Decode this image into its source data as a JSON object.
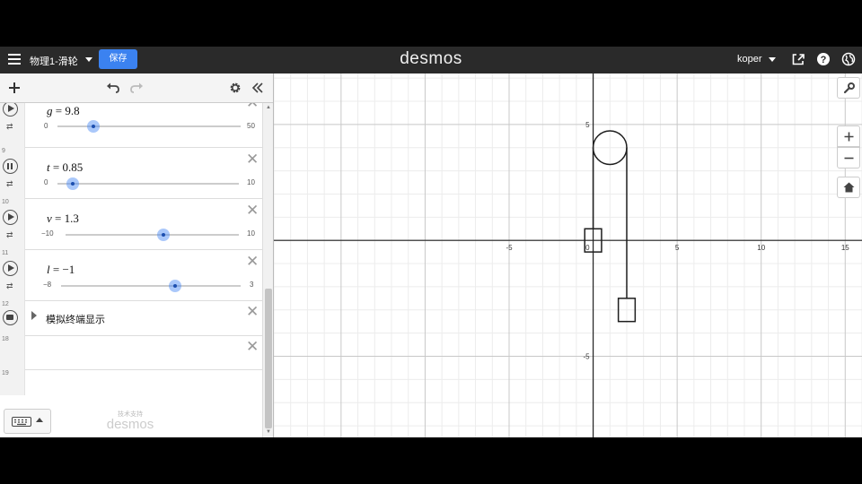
{
  "header": {
    "graph_title": "物理1-滑轮",
    "save_label": "保存",
    "logo": "desmos",
    "user_name": "koper"
  },
  "expressions": [
    {
      "row_number": "",
      "lhs": "g",
      "rhs": "9.8",
      "slider_min": "0",
      "slider_max": "50",
      "state": "play",
      "fraction": 0.196
    },
    {
      "row_number": "9",
      "lhs": "t",
      "rhs": "0.85",
      "slider_min": "0",
      "slider_max": "10",
      "state": "pause",
      "fraction": 0.085
    },
    {
      "row_number": "10",
      "lhs": "v",
      "rhs": "1.3",
      "slider_min": "−10",
      "slider_max": "10",
      "state": "play",
      "fraction": 0.565
    },
    {
      "row_number": "11",
      "lhs": "l",
      "rhs": "−1",
      "slider_min": "−8",
      "slider_max": "3",
      "state": "play",
      "fraction": 0.636
    }
  ],
  "folder": {
    "row_number": "12",
    "label": "模拟终端显示"
  },
  "empty_rows": [
    "18",
    "19"
  ],
  "footer": {
    "powered_by": "技术支持",
    "logo": "desmos"
  },
  "graph": {
    "x_range": [
      -19,
      16
    ],
    "y_range": [
      -8.5,
      7.2
    ],
    "x_ticks": [
      "-5",
      "5",
      "10",
      "15"
    ],
    "y_ticks": [
      "5",
      "-5"
    ],
    "origin_label": "0",
    "pulley": {
      "center": [
        1,
        4
      ],
      "radius": 1
    },
    "left_box": {
      "center": [
        0,
        0
      ],
      "size": 1
    },
    "right_box": {
      "center": [
        2,
        -3
      ],
      "size": 1
    }
  },
  "icons": [
    "menu-icon",
    "share-icon",
    "help-icon",
    "globe-icon",
    "add-icon",
    "undo-icon",
    "redo-icon",
    "settings-icon",
    "collapse-icon",
    "wrench-icon",
    "zoom-in-icon",
    "zoom-out-icon",
    "home-icon",
    "keyboard-icon"
  ],
  "colors": {
    "header": "#2a2a2a",
    "save_button": "#3b82f0",
    "slider_thumb": "#4285f4"
  }
}
